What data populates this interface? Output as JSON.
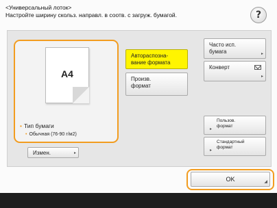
{
  "header": {
    "title": "<Универсальный лоток>",
    "instruction": "Настройте ширину скольз. направл. в соотв. с загруж. бумагой."
  },
  "help_button": {
    "label": "?"
  },
  "preview": {
    "paper_size": "A4",
    "paper_type_label": "Тип бумаги",
    "paper_type_value": "Обычная (76-90 г/м2)",
    "bullet": "•",
    "sub_bullet": "•"
  },
  "buttons": {
    "change": "Измен.",
    "auto_detect": "Автораспозна-\nвание формата",
    "custom_size": "Произв.\nформат",
    "frequent_paper": "Часто исп.\nбумага",
    "envelope": "Конверт",
    "user_size": "Пользов.\nформат",
    "standard_size": "Стандартный\nформат",
    "ok": "OK"
  },
  "colors": {
    "accent_orange": "#f29c1f",
    "selected_yellow": "#fff500",
    "bottom_bar": "#1e1e1e"
  },
  "icons": {
    "help": "question-mark-icon",
    "envelope": "envelope-icon",
    "corner": "corner-arrow-icon"
  }
}
